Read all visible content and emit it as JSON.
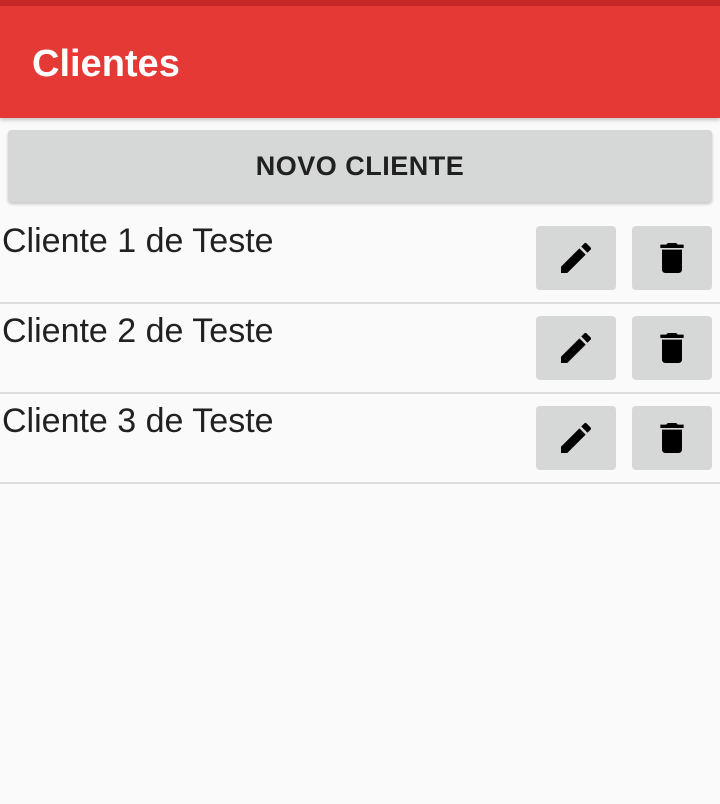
{
  "app_bar": {
    "title": "Clientes",
    "color": "#e53935"
  },
  "new_client_button": {
    "label": "NOVO CLIENTE"
  },
  "clients": [
    {
      "name": "Cliente 1 de Teste",
      "edit_icon": "pencil-icon",
      "delete_icon": "trash-icon"
    },
    {
      "name": "Cliente 2 de Teste",
      "edit_icon": "pencil-icon",
      "delete_icon": "trash-icon"
    },
    {
      "name": "Cliente 3 de Teste",
      "edit_icon": "pencil-icon",
      "delete_icon": "trash-icon"
    }
  ]
}
